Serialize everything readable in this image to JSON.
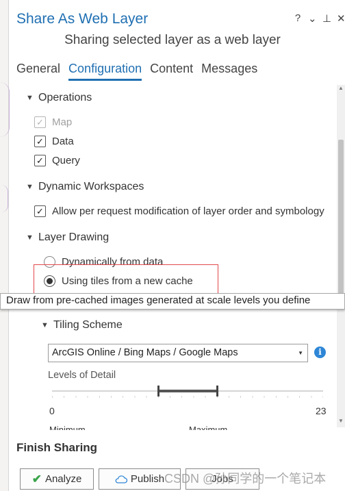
{
  "window": {
    "title": "Share As Web Layer",
    "controls": [
      "?",
      "⌄",
      "⊥",
      "✕"
    ],
    "subtitle": "Sharing selected layer as a web layer"
  },
  "tabs": [
    {
      "label": "General",
      "active": false
    },
    {
      "label": "Configuration",
      "active": true
    },
    {
      "label": "Content",
      "active": false
    },
    {
      "label": "Messages",
      "active": false
    }
  ],
  "operations": {
    "header": "Operations",
    "items": [
      {
        "label": "Map",
        "checked": true,
        "disabled": true
      },
      {
        "label": "Data",
        "checked": true,
        "disabled": false
      },
      {
        "label": "Query",
        "checked": true,
        "disabled": false
      }
    ]
  },
  "dynamic_workspaces": {
    "header": "Dynamic Workspaces",
    "option": {
      "label": "Allow per request modification of layer order and symbology",
      "checked": true
    }
  },
  "layer_drawing": {
    "header": "Layer Drawing",
    "options": [
      {
        "label": "Dynamically from data",
        "selected": false
      },
      {
        "label": "Using tiles from a new cache",
        "selected": true
      }
    ],
    "tooltip": "Draw from pre-cached images generated at scale levels you define"
  },
  "tiling_scheme": {
    "header": "Tiling Scheme",
    "selected": "ArcGIS Online / Bing Maps / Google Maps",
    "info_icon": "i",
    "levels_label": "Levels of Detail",
    "range_min": "0",
    "range_max": "23",
    "current_min_level": 9,
    "current_max_level": 14,
    "minimum_label": "Minimum",
    "maximum_label": "Maximum"
  },
  "finish": {
    "header": "Finish Sharing",
    "analyze": "Analyze",
    "publish": "Publish",
    "jobs": "Jobs"
  },
  "watermark": "CSDN @孙同学的一个笔记本",
  "colors": {
    "accent": "#1f6fb2",
    "highlight_box": "#e2474b",
    "info": "#2e86d6",
    "check": "#3aa34a"
  }
}
